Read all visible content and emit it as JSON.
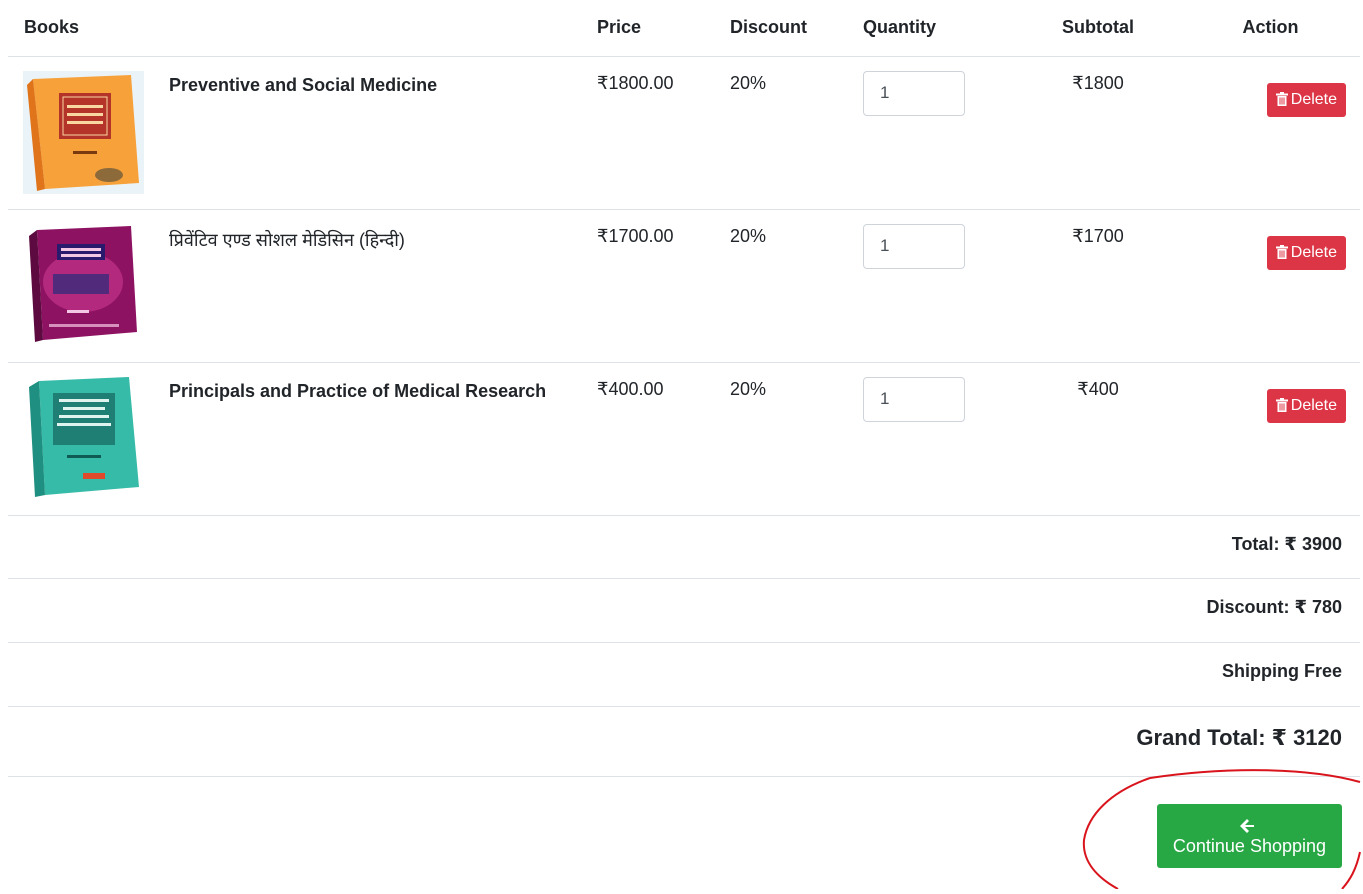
{
  "table": {
    "headers": {
      "books": "Books",
      "price": "Price",
      "discount": "Discount",
      "quantity": "Quantity",
      "subtotal": "Subtotal",
      "action": "Action"
    },
    "items": [
      {
        "title": "Preventive and Social Medicine",
        "price": "₹1800.00",
        "discount": "20%",
        "quantity": "1",
        "subtotal": "₹1800",
        "delete_label": "Delete",
        "cover_color": "#f5891f"
      },
      {
        "title": "प्रिवेंटिव एण्ड सोशल मेडिसिन (हिन्दी)",
        "price": "₹1700.00",
        "discount": "20%",
        "quantity": "1",
        "subtotal": "₹1700",
        "delete_label": "Delete",
        "cover_color": "#9b1466"
      },
      {
        "title": "Principals and Practice of Medical Research",
        "price": "₹400.00",
        "discount": "20%",
        "quantity": "1",
        "subtotal": "₹400",
        "delete_label": "Delete",
        "cover_color": "#2fb5a3"
      }
    ]
  },
  "summary": {
    "total": "Total: ₹ 3900",
    "discount": "Discount: ₹ 780",
    "shipping": "Shipping Free",
    "grand_total": "Grand Total: ₹ 3120"
  },
  "actions": {
    "continue_shopping": "Continue Shopping"
  },
  "colors": {
    "delete_button": "#dc3545",
    "continue_button": "#28a745",
    "annotation_circle": "#d9141c"
  },
  "icons": {
    "delete": "trash-icon",
    "continue": "arrow-left-icon"
  }
}
